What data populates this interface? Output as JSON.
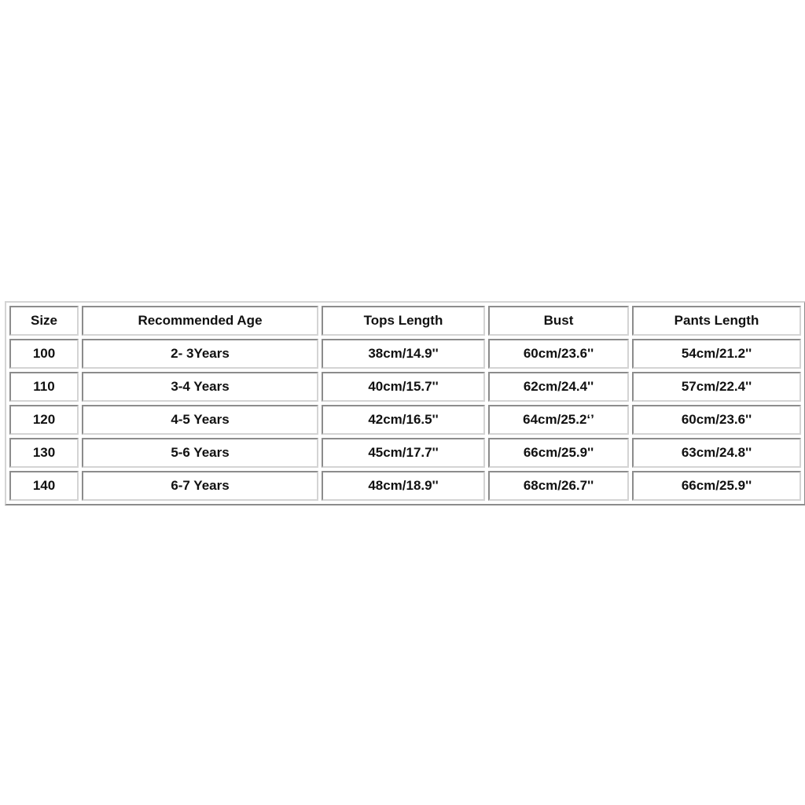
{
  "table": {
    "headers": [
      "Size",
      "Recommended Age",
      "Tops Length",
      "Bust",
      "Pants Length"
    ],
    "rows": [
      [
        "100",
        "2- 3Years",
        "38cm/14.9''",
        "60cm/23.6''",
        "54cm/21.2''"
      ],
      [
        "110",
        "3-4 Years",
        "40cm/15.7''",
        "62cm/24.4''",
        "57cm/22.4''"
      ],
      [
        "120",
        "4-5 Years",
        "42cm/16.5''",
        "64cm/25.2‘’",
        "60cm/23.6''"
      ],
      [
        "130",
        "5-6 Years",
        "45cm/17.7''",
        "66cm/25.9''",
        "63cm/24.8''"
      ],
      [
        "140",
        "6-7 Years",
        "48cm/18.9''",
        "68cm/26.7''",
        "66cm/25.9''"
      ]
    ]
  },
  "colors": {
    "border_light": "#d4d4d4",
    "border_dark": "#8c8c8c",
    "text": "#111111",
    "background": "#ffffff"
  }
}
